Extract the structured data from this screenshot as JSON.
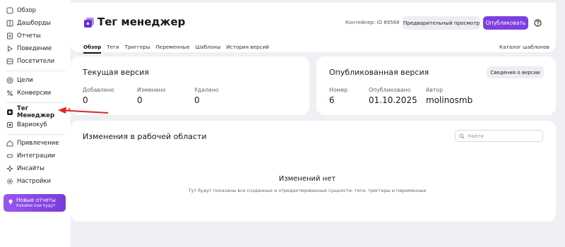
{
  "sidebar": {
    "items": [
      {
        "label": "Обзор",
        "icon": "grid-icon"
      },
      {
        "label": "Дашборды",
        "icon": "dashboard-icon"
      },
      {
        "label": "Отчеты",
        "icon": "report-icon"
      },
      {
        "label": "Поведение",
        "icon": "play-icon"
      },
      {
        "label": "Посетители",
        "icon": "visitors-icon"
      },
      {
        "label": "Цели",
        "icon": "target-icon"
      },
      {
        "label": "Конверсии",
        "icon": "percent-icon"
      },
      {
        "label": "Тег Менеджер",
        "icon": "tag-manager-icon",
        "badge": "β"
      },
      {
        "label": "Вариокуб",
        "icon": "variocube-icon"
      },
      {
        "label": "Привлечение",
        "icon": "home-icon"
      },
      {
        "label": "Интеграции",
        "icon": "integration-icon"
      },
      {
        "label": "Инсайты",
        "icon": "insights-icon"
      },
      {
        "label": "Настройки",
        "icon": "gear-icon"
      }
    ],
    "promo": {
      "title": "Новые отчеты",
      "subtitle": "Какими они будут"
    }
  },
  "header": {
    "title": "Тег менеджер",
    "container_id": "Контейнер: ID 69568",
    "preview_label": "Предварительный просмотр",
    "publish_label": "Опубликовать",
    "tabs": [
      "Обзор",
      "Теги",
      "Триггеры",
      "Переменные",
      "Шаблоны",
      "История версий"
    ],
    "active_tab": "Обзор",
    "catalog_label": "Каталог шаблонов"
  },
  "current_version": {
    "title": "Текущая версия",
    "stats": [
      {
        "label": "Добавлено",
        "value": "0"
      },
      {
        "label": "Изменено",
        "value": "0"
      },
      {
        "label": "Удалено",
        "value": "0"
      }
    ]
  },
  "published_version": {
    "title": "Опубликованная версия",
    "details_label": "Сведения о версии",
    "stats": [
      {
        "label": "Номер",
        "value": "6"
      },
      {
        "label": "Опубликовано",
        "value": "01.10.2025"
      },
      {
        "label": "Автор",
        "value": "molinosmb"
      }
    ]
  },
  "workspace": {
    "title": "Изменения в рабочей области",
    "search_placeholder": "Найти",
    "empty_title": "Изменений нет",
    "empty_subtitle": "Тут будут показаны все созданные и отредактированные сущности: теги, триггеры и переменные"
  },
  "colors": {
    "accent": "#7d3fe0",
    "arrow": "#e02424",
    "background": "#eef0f4"
  }
}
